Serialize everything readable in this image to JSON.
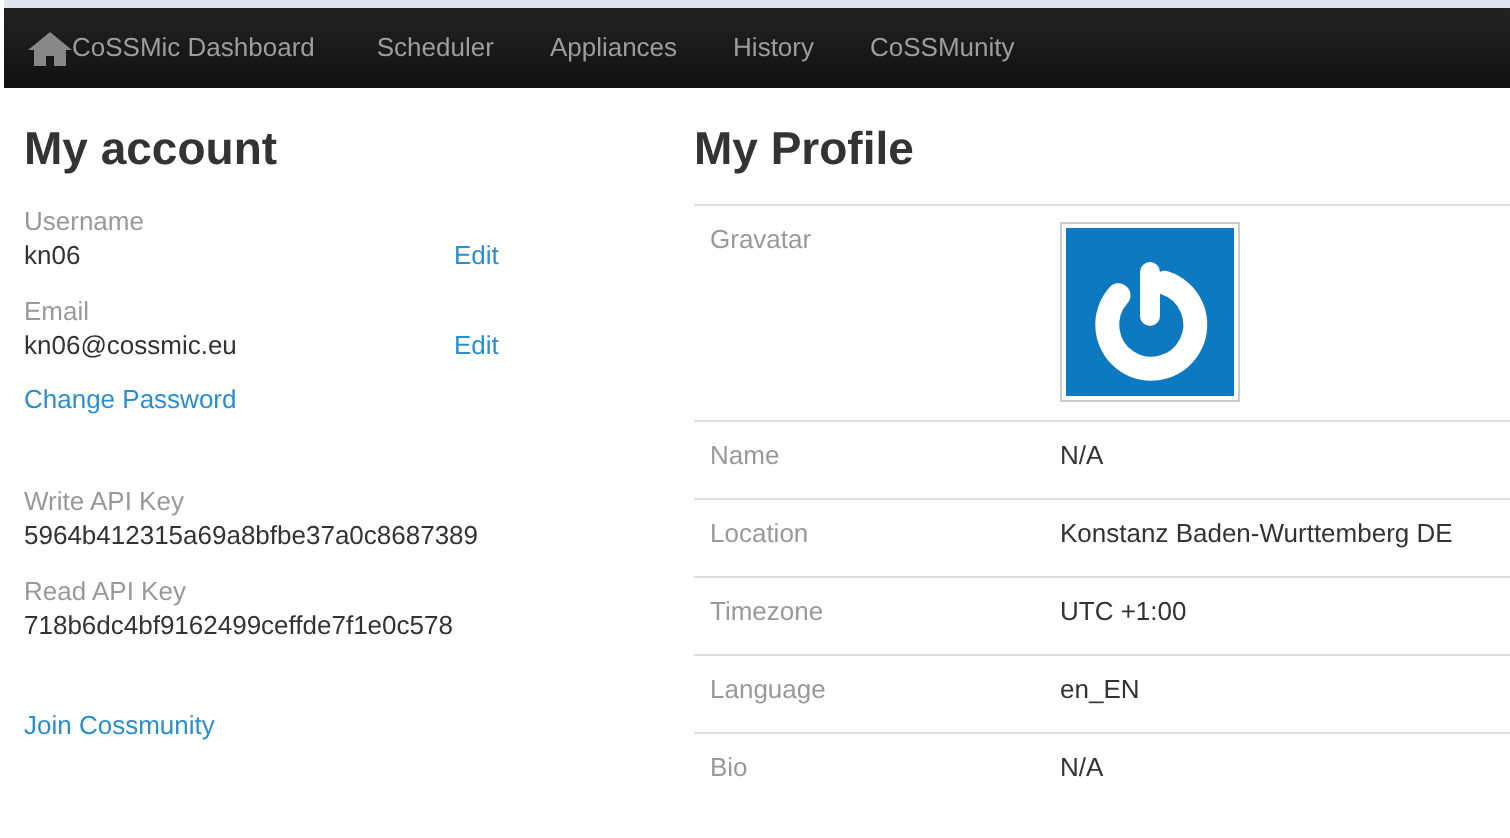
{
  "navbar": {
    "brand": "CoSSMic Dashboard",
    "items": [
      "Scheduler",
      "Appliances",
      "History",
      "CoSSMunity"
    ]
  },
  "account": {
    "title": "My account",
    "fields": [
      {
        "label": "Username",
        "value": "kn06",
        "action": "Edit"
      },
      {
        "label": "Email",
        "value": "kn06@cossmic.eu",
        "action": "Edit"
      }
    ],
    "change_password": "Change Password",
    "keys": [
      {
        "label": "Write API Key",
        "value": "5964b412315a69a8bfbe37a0c8687389"
      },
      {
        "label": "Read API Key",
        "value": "718b6dc4bf9162499ceffde7f1e0c578"
      }
    ],
    "join": "Join Cossmunity"
  },
  "profile": {
    "title": "My Profile",
    "rows": [
      {
        "kind": "image",
        "label": "Gravatar"
      },
      {
        "kind": "text",
        "label": "Name",
        "value": "N/A"
      },
      {
        "kind": "text",
        "label": "Location",
        "value": "Konstanz Baden-Wurttemberg DE"
      },
      {
        "kind": "text",
        "label": "Timezone",
        "value": "UTC +1:00"
      },
      {
        "kind": "text",
        "label": "Language",
        "value": "en_EN"
      },
      {
        "kind": "text",
        "label": "Bio",
        "value": "N/A"
      }
    ]
  }
}
